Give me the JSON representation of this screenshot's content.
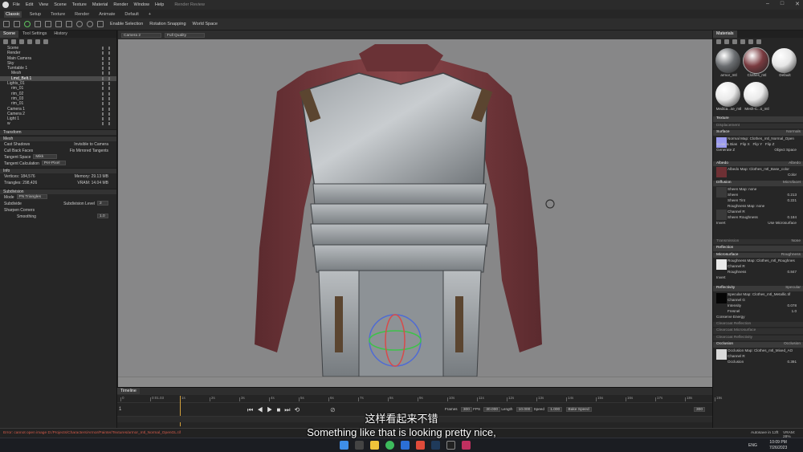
{
  "menubar": {
    "items": [
      "File",
      "Edit",
      "View",
      "Scene",
      "Texture",
      "Material",
      "Render",
      "Window",
      "Help"
    ],
    "title": "Render Review"
  },
  "modes": {
    "tabs": [
      "Classic",
      "Setup",
      "Texture",
      "Render",
      "Animate",
      "Default",
      "+"
    ],
    "active": 0
  },
  "toolbar": {
    "enable_selection": "Enable Selection",
    "rotation_snapping": "Rotation Snapping",
    "world_space": "World Space"
  },
  "scene_panel": {
    "tabs": [
      "Scene",
      "Tool Settings",
      "History"
    ],
    "tree": [
      "Scene",
      "Render",
      "Main Camera",
      "Sky",
      "Turntable 1",
      "Mesh",
      "Lmd_Belt.1",
      "Lights_01",
      "rim_01",
      "rim_02",
      "rim_03",
      "rim_01",
      "Camera 1",
      "Camera 2",
      "Light 1",
      "w"
    ],
    "selected_index": 6,
    "transform": "Transform",
    "mesh": "Mesh",
    "cast_shadows": "Cast Shadows",
    "invisible_to_camera": "Invisible to Camera",
    "cull_back_faces": "Cull Back Faces",
    "fix_mirrored_tangents": "Fix Mirrored Tangents",
    "tangent_space_label": "Tangent Space",
    "tangent_space_value": "Mikk",
    "tangent_calc_label": "Tangent Calculation",
    "tangent_calc_value": "Per-Pixel",
    "info": "Info",
    "vertices_label": "Vertices",
    "vertices_value": "184,576",
    "memory_label": "Memory",
    "memory_value": "29.13 MB",
    "triangles_label": "Triangles",
    "triangles_value": "298,426",
    "vram_label": "VRAM",
    "vram_value": "14.04 MB",
    "subdivision": "Subdivision",
    "mode_label": "Mode",
    "mode_value": "PN Triangles",
    "subdivide": "Subdivide",
    "subdiv_level_label": "Subdivision Level",
    "subdiv_level_value": "2",
    "sharpen_corners": "Sharpen Corners",
    "smoothing_label": "Smoothing",
    "smoothing_value": "1.0"
  },
  "viewport": {
    "camera": "Camera 2",
    "quality": "Full Quality"
  },
  "materials_panel": {
    "title": "Materials",
    "thumbs": [
      {
        "name": "armor_mtl",
        "color": "#6a6d70"
      },
      {
        "name": "Clothes_mtl",
        "color": "#7a3b40"
      },
      {
        "name": "Default",
        "color": "#e6e6e6"
      },
      {
        "name": "Medica...se_mtl",
        "color": "#e9e9e9"
      },
      {
        "name": "Mesh-C...s_mtl",
        "color": "#e9e9e9"
      }
    ],
    "selected_thumb": 1,
    "texture": "Texture",
    "displacement": "Displacement",
    "surface": "Surface",
    "surface_type": "Normals",
    "normal_map": "Normal Map:",
    "normal_map_file": "Clothes_mtl_Normal_Open",
    "scale_bias": "Scale & Bias",
    "flip_x": "Flip X",
    "flip_y": "Flip Y",
    "flip_z": "Flip Z",
    "generate_z": "Generate Z",
    "object_space": "Object Space",
    "albedo": "Albedo",
    "albedo_type": "Albedo",
    "albedo_map": "Albedo Map:",
    "albedo_map_file": "Clothes_mtl_Base_color",
    "color": "Color",
    "diffusion": "Diffusion",
    "diffusion_type": "Microfacet",
    "sheen_map": "Sheen Map:",
    "sheen_map_file": "none",
    "sheen": "Sheen",
    "sheen_value": "0.213",
    "sheen_tint": "Sheen Tint",
    "sheen_tint_value": "0.221",
    "roughness_map_sheen": "Roughness Map:",
    "roughness_map_sheen_file": "none",
    "channel": "Channel",
    "channel_r": "R",
    "sheen_roughness": "Sheen Roughness",
    "sheen_roughness_value": "0.184",
    "invert": "Invert",
    "use_microsurface": "Use Microsurface",
    "transmission": "Transmission",
    "transmission_type": "None",
    "reflection": "Reflection",
    "microsurface": "Microsurface",
    "microsurface_type": "Roughness",
    "roughness_map": "Roughness Map:",
    "roughness_map_file": "Clothes_mtl_Roughnes",
    "roughness": "Roughness",
    "roughness_value": "0.847",
    "reflectivity": "Reflectivity",
    "reflectivity_type": "Specular",
    "specular_map": "Specular Map:",
    "specular_map_file": "Clothes_mtl_Metallic.tif",
    "channel_g": "G",
    "intensity": "Intensity",
    "intensity_value": "0.078",
    "fresnel": "Fresnel",
    "fresnel_value": "1.0",
    "conserve_energy": "Conserve Energy",
    "clearcoat_reflection": "Clearcoat Reflection",
    "clearcoat_microsurface": "Clearcoat Microsurface",
    "clearcoat_reflectivity": "Clearcoat Reflectivity",
    "occlusion_sect": "Occlusion",
    "occlusion_type": "Occlusion",
    "occlusion_map": "Occlusion Map:",
    "occlusion_map_file": "Clothes_mtl_Mixed_AO",
    "occlusion": "Occlusion",
    "occlusion_value": "0.391"
  },
  "timeline": {
    "title": "Timeline",
    "ruler_labels": [
      "0",
      "0:01.03",
      "1s",
      "2s",
      "3s",
      "4s",
      "5s",
      "6s",
      "7s",
      "8s",
      "9s",
      "10s",
      "11s",
      "12s",
      "13s",
      "14s",
      "15s",
      "16s",
      "17s",
      "18s",
      "19s"
    ],
    "frames_label": "Frames",
    "frames_value": "300",
    "fps_label": "FPS",
    "fps_value": "30.000",
    "length_label": "Length",
    "length_value": "10.000",
    "speed_label": "Speed",
    "speed_value": "1.000",
    "bake_speed": "Bake Speed",
    "end_value": "300",
    "start_value": "1"
  },
  "status": {
    "error": "Error: cannot open image D:/Projects/Characters/Armor/Painter/Textures/armor_mtl_Normal_OpenGL.tif",
    "autosave": "Autosave in 12ft",
    "vram": "VRAM: 28%"
  },
  "taskbar": {
    "time": "10:09 PM",
    "date": "7/26/2023",
    "lang": "ENG"
  },
  "subtitle": {
    "chinese": "这样看起来不错",
    "english": "Something like that is looking pretty nice,"
  }
}
